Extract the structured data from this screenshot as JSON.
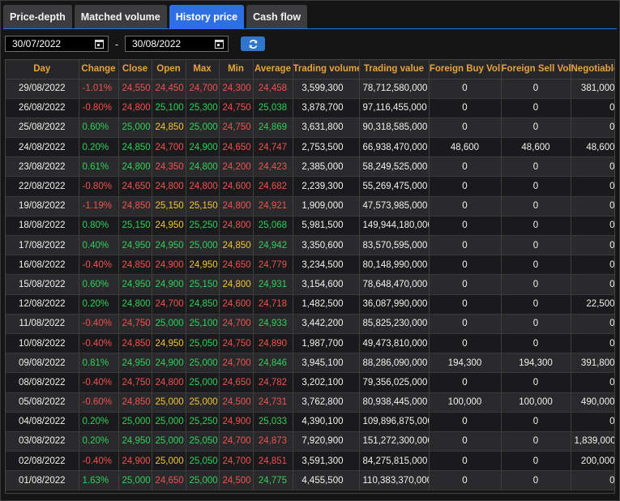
{
  "tabs": [
    "Price-depth",
    "Matched volume",
    "History price",
    "Cash flow"
  ],
  "active_tab": 2,
  "filters": {
    "from_date": "30/07/2022",
    "to_date": "30/08/2022",
    "separator": "-"
  },
  "columns": [
    "Day",
    "Change",
    "Close",
    "Open",
    "Max",
    "Min",
    "Average",
    "Trading volume",
    "Trading value",
    "Foreign Buy Vol",
    "Foreign Sell Vol",
    "Negotiable"
  ],
  "colors": {
    "up": "#2fd05a",
    "down": "#f0514f",
    "ref": "#f1c531",
    "accent": "#2f6fe4",
    "header": "#e8a33a"
  },
  "rows": [
    {
      "day": "29/08/2022",
      "change": "-1.01%",
      "close": "24,550",
      "open": "24,450",
      "max": "24,700",
      "min": "24,300",
      "avg": "24,458",
      "vol": "3,599,300",
      "value": "78,712,580,000",
      "fbuy": "0",
      "fsell": "0",
      "neg": "381,000",
      "c": [
        "r",
        "r",
        "r",
        "r",
        "r",
        "r"
      ]
    },
    {
      "day": "26/08/2022",
      "change": "-0.80%",
      "close": "24,800",
      "open": "25,100",
      "max": "25,300",
      "min": "24,750",
      "avg": "25,038",
      "vol": "3,878,700",
      "value": "97,116,455,000",
      "fbuy": "0",
      "fsell": "0",
      "neg": "0",
      "c": [
        "r",
        "r",
        "g",
        "g",
        "r",
        "g"
      ]
    },
    {
      "day": "25/08/2022",
      "change": "0.60%",
      "close": "25,000",
      "open": "24,850",
      "max": "25,000",
      "min": "24,750",
      "avg": "24,869",
      "vol": "3,631,800",
      "value": "90,318,585,000",
      "fbuy": "0",
      "fsell": "0",
      "neg": "0",
      "c": [
        "g",
        "g",
        "y",
        "g",
        "r",
        "g"
      ]
    },
    {
      "day": "24/08/2022",
      "change": "0.20%",
      "close": "24,850",
      "open": "24,700",
      "max": "24,900",
      "min": "24,650",
      "avg": "24,747",
      "vol": "2,753,500",
      "value": "66,938,470,000",
      "fbuy": "48,600",
      "fsell": "48,600",
      "neg": "48,600",
      "c": [
        "g",
        "g",
        "r",
        "g",
        "r",
        "r"
      ]
    },
    {
      "day": "23/08/2022",
      "change": "0.61%",
      "close": "24,800",
      "open": "24,350",
      "max": "24,800",
      "min": "24,200",
      "avg": "24,423",
      "vol": "2,385,000",
      "value": "58,249,525,000",
      "fbuy": "0",
      "fsell": "0",
      "neg": "0",
      "c": [
        "g",
        "g",
        "r",
        "g",
        "r",
        "r"
      ]
    },
    {
      "day": "22/08/2022",
      "change": "-0.80%",
      "close": "24,650",
      "open": "24,800",
      "max": "24,800",
      "min": "24,600",
      "avg": "24,682",
      "vol": "2,239,300",
      "value": "55,269,475,000",
      "fbuy": "0",
      "fsell": "0",
      "neg": "0",
      "c": [
        "r",
        "r",
        "r",
        "r",
        "r",
        "r"
      ]
    },
    {
      "day": "19/08/2022",
      "change": "-1.19%",
      "close": "24,850",
      "open": "25,150",
      "max": "25,150",
      "min": "24,800",
      "avg": "24,921",
      "vol": "1,909,000",
      "value": "47,573,985,000",
      "fbuy": "0",
      "fsell": "0",
      "neg": "0",
      "c": [
        "r",
        "r",
        "y",
        "y",
        "r",
        "r"
      ]
    },
    {
      "day": "18/08/2022",
      "change": "0.80%",
      "close": "25,150",
      "open": "24,950",
      "max": "25,250",
      "min": "24,800",
      "avg": "25,068",
      "vol": "5,981,500",
      "value": "149,944,180,000",
      "fbuy": "0",
      "fsell": "0",
      "neg": "0",
      "c": [
        "g",
        "g",
        "y",
        "g",
        "r",
        "g"
      ]
    },
    {
      "day": "17/08/2022",
      "change": "0.40%",
      "close": "24,950",
      "open": "24,950",
      "max": "25,000",
      "min": "24,850",
      "avg": "24,942",
      "vol": "3,350,600",
      "value": "83,570,595,000",
      "fbuy": "0",
      "fsell": "0",
      "neg": "0",
      "c": [
        "g",
        "g",
        "g",
        "g",
        "y",
        "g"
      ]
    },
    {
      "day": "16/08/2022",
      "change": "-0.40%",
      "close": "24,850",
      "open": "24,900",
      "max": "24,950",
      "min": "24,650",
      "avg": "24,779",
      "vol": "3,234,500",
      "value": "80,148,990,000",
      "fbuy": "0",
      "fsell": "0",
      "neg": "0",
      "c": [
        "r",
        "r",
        "r",
        "y",
        "r",
        "r"
      ]
    },
    {
      "day": "15/08/2022",
      "change": "0.60%",
      "close": "24,950",
      "open": "24,900",
      "max": "25,150",
      "min": "24,800",
      "avg": "24,931",
      "vol": "3,154,600",
      "value": "78,648,470,000",
      "fbuy": "0",
      "fsell": "0",
      "neg": "0",
      "c": [
        "g",
        "g",
        "g",
        "g",
        "y",
        "g"
      ]
    },
    {
      "day": "12/08/2022",
      "change": "0.20%",
      "close": "24,800",
      "open": "24,700",
      "max": "24,850",
      "min": "24,600",
      "avg": "24,718",
      "vol": "1,482,500",
      "value": "36,087,990,000",
      "fbuy": "0",
      "fsell": "0",
      "neg": "22,500",
      "c": [
        "g",
        "g",
        "r",
        "g",
        "r",
        "r"
      ]
    },
    {
      "day": "11/08/2022",
      "change": "-0.40%",
      "close": "24,750",
      "open": "25,000",
      "max": "25,100",
      "min": "24,700",
      "avg": "24,933",
      "vol": "3,442,200",
      "value": "85,825,230,000",
      "fbuy": "0",
      "fsell": "0",
      "neg": "0",
      "c": [
        "r",
        "r",
        "g",
        "g",
        "r",
        "g"
      ]
    },
    {
      "day": "10/08/2022",
      "change": "-0.40%",
      "close": "24,850",
      "open": "24,950",
      "max": "25,050",
      "min": "24,750",
      "avg": "24,890",
      "vol": "1,987,700",
      "value": "49,473,810,000",
      "fbuy": "0",
      "fsell": "0",
      "neg": "0",
      "c": [
        "r",
        "r",
        "y",
        "g",
        "r",
        "r"
      ]
    },
    {
      "day": "09/08/2022",
      "change": "0.81%",
      "close": "24,950",
      "open": "24,900",
      "max": "25,000",
      "min": "24,700",
      "avg": "24,846",
      "vol": "3,945,100",
      "value": "88,286,090,000",
      "fbuy": "194,300",
      "fsell": "194,300",
      "neg": "391,800",
      "c": [
        "g",
        "g",
        "g",
        "g",
        "r",
        "g"
      ]
    },
    {
      "day": "08/08/2022",
      "change": "-0.40%",
      "close": "24,750",
      "open": "24,800",
      "max": "25,000",
      "min": "24,650",
      "avg": "24,782",
      "vol": "3,202,100",
      "value": "79,356,025,000",
      "fbuy": "0",
      "fsell": "0",
      "neg": "0",
      "c": [
        "r",
        "r",
        "r",
        "g",
        "r",
        "r"
      ]
    },
    {
      "day": "05/08/2022",
      "change": "-0.60%",
      "close": "24,850",
      "open": "25,000",
      "max": "25,000",
      "min": "24,500",
      "avg": "24,731",
      "vol": "3,762,800",
      "value": "80,938,445,000",
      "fbuy": "100,000",
      "fsell": "100,000",
      "neg": "490,000",
      "c": [
        "r",
        "r",
        "y",
        "y",
        "r",
        "r"
      ]
    },
    {
      "day": "04/08/2022",
      "change": "0.20%",
      "close": "25,000",
      "open": "25,000",
      "max": "25,250",
      "min": "24,900",
      "avg": "25,033",
      "vol": "4,390,100",
      "value": "109,896,875,000",
      "fbuy": "0",
      "fsell": "0",
      "neg": "0",
      "c": [
        "g",
        "g",
        "g",
        "g",
        "r",
        "g"
      ]
    },
    {
      "day": "03/08/2022",
      "change": "0.20%",
      "close": "24,950",
      "open": "25,000",
      "max": "25,050",
      "min": "24,700",
      "avg": "24,873",
      "vol": "7,920,900",
      "value": "151,272,300,000",
      "fbuy": "0",
      "fsell": "0",
      "neg": "1,839,000",
      "c": [
        "g",
        "g",
        "g",
        "g",
        "r",
        "r"
      ]
    },
    {
      "day": "02/08/2022",
      "change": "-0.40%",
      "close": "24,900",
      "open": "25,000",
      "max": "25,050",
      "min": "24,700",
      "avg": "24,851",
      "vol": "3,591,300",
      "value": "84,275,815,000",
      "fbuy": "0",
      "fsell": "0",
      "neg": "200,000",
      "c": [
        "r",
        "r",
        "y",
        "g",
        "r",
        "r"
      ]
    },
    {
      "day": "01/08/2022",
      "change": "1.63%",
      "close": "25,000",
      "open": "24,650",
      "max": "25,000",
      "min": "24,500",
      "avg": "24,775",
      "vol": "4,455,500",
      "value": "110,383,370,000",
      "fbuy": "0",
      "fsell": "0",
      "neg": "0",
      "c": [
        "g",
        "g",
        "r",
        "g",
        "r",
        "g"
      ]
    }
  ]
}
